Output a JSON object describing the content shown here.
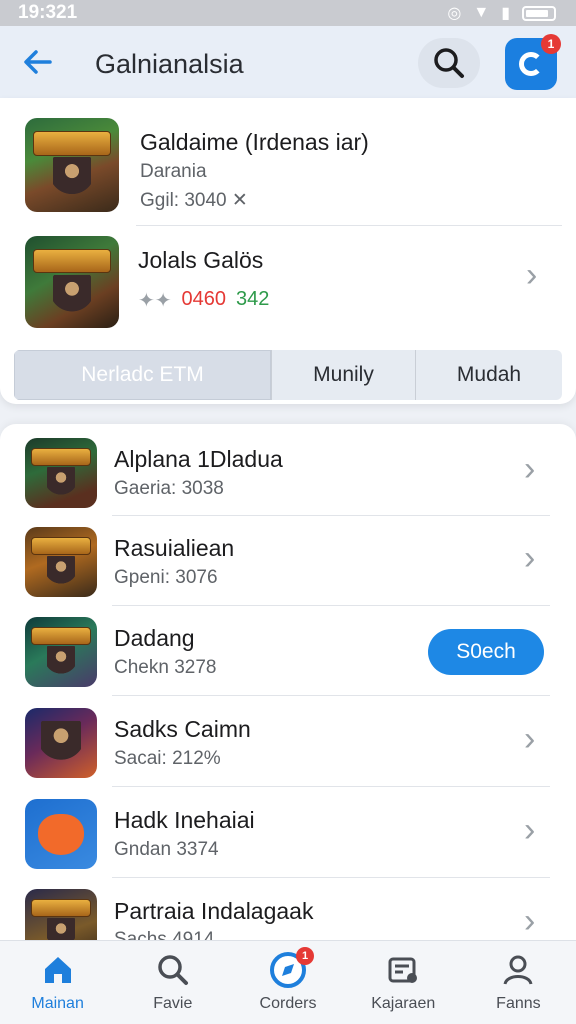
{
  "status_bar": {
    "time": "19:321"
  },
  "header": {
    "title": "Galnianalsia"
  },
  "featured": [
    {
      "title": "Galdaime (Irdenas iar)",
      "subtitle": "Darania",
      "meta": "Ggil: 3040 ✕"
    },
    {
      "title": "Jolals Galös",
      "rating_text": "✦✦",
      "price_red": "0460",
      "price_green": "342"
    }
  ],
  "tabs": [
    {
      "label": "Nerladc ETM",
      "active": true
    },
    {
      "label": "Munily",
      "active": false
    },
    {
      "label": "Mudah",
      "active": false
    }
  ],
  "list": [
    {
      "title": "Alplana 1Dladua",
      "subtitle": "Gaeria: 3038"
    },
    {
      "title": "Rasuialiean",
      "subtitle": "Gpeni: 3076"
    },
    {
      "title": "Dadang",
      "subtitle": "Chekn 3278",
      "action_label": "S0ech"
    },
    {
      "title": "Sadks Caimn",
      "subtitle": "Sacai: 212%"
    },
    {
      "title": "Hadk Inehaiai",
      "subtitle": "Gndan 3374"
    },
    {
      "title": "Partraia Indalagaak",
      "subtitle": "Sachs 4914"
    }
  ],
  "bottom_nav": [
    {
      "label": "Mainan",
      "icon": "home-icon",
      "active": true
    },
    {
      "label": "Favie",
      "icon": "search-icon",
      "active": false
    },
    {
      "label": "Corders",
      "icon": "compass-icon",
      "active": false,
      "badge": "1"
    },
    {
      "label": "Kajaraen",
      "icon": "inbox-icon",
      "active": false
    },
    {
      "label": "Fanns",
      "icon": "profile-icon",
      "active": false
    }
  ],
  "badges": {
    "app_button": "1"
  },
  "colors": {
    "accent": "#1e88e5",
    "price_red": "#e53935",
    "price_green": "#2e9a4a"
  }
}
